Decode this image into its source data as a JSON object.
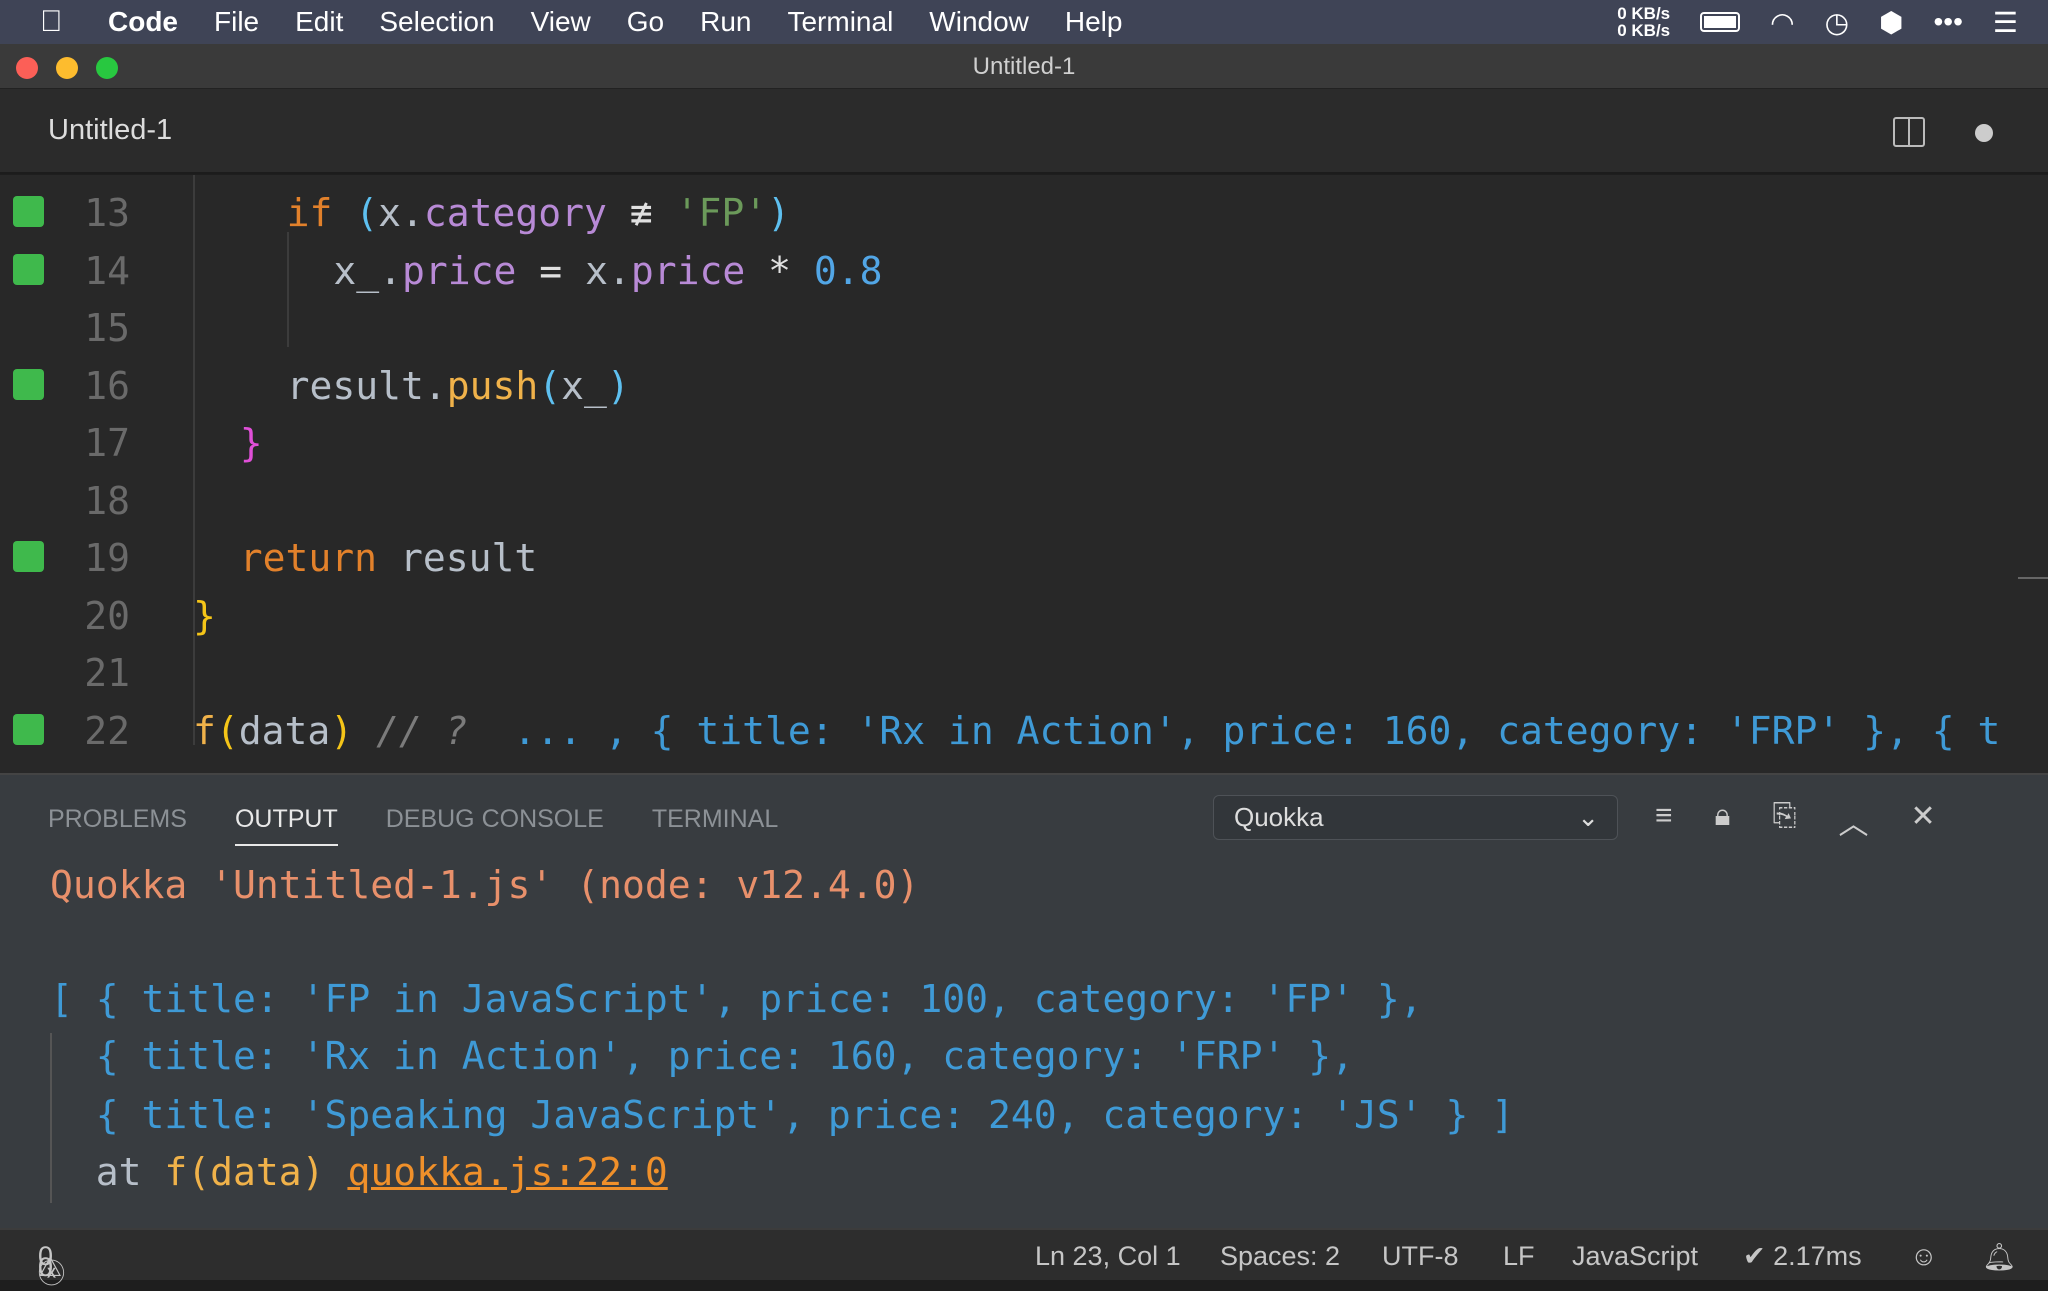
{
  "menubar": {
    "apple": "",
    "items": [
      "Code",
      "File",
      "Edit",
      "Selection",
      "View",
      "Go",
      "Run",
      "Terminal",
      "Window",
      "Help"
    ],
    "net_up": "0 KB/s",
    "net_down": "0 KB/s"
  },
  "window": {
    "title": "Untitled-1"
  },
  "tab": {
    "label": "Untitled-1"
  },
  "editor": {
    "lines": [
      {
        "n": "13",
        "mark": true,
        "indent": 4,
        "tokens": [
          {
            "t": "if",
            "c": "kw"
          },
          {
            "t": " ",
            "c": "tx"
          },
          {
            "t": "(",
            "c": "bb"
          },
          {
            "t": "x.",
            "c": "tx"
          },
          {
            "t": "category",
            "c": "pr"
          },
          {
            "t": " ≢ ",
            "c": "op"
          },
          {
            "t": "'FP'",
            "c": "st"
          },
          {
            "t": ")",
            "c": "bb"
          }
        ]
      },
      {
        "n": "14",
        "mark": true,
        "indent": 6,
        "tokens": [
          {
            "t": "x_.",
            "c": "tx"
          },
          {
            "t": "price",
            "c": "pr"
          },
          {
            "t": " = ",
            "c": "op"
          },
          {
            "t": "x.",
            "c": "tx"
          },
          {
            "t": "price",
            "c": "pr"
          },
          {
            "t": " * ",
            "c": "op"
          },
          {
            "t": "0.8",
            "c": "nu"
          }
        ]
      },
      {
        "n": "15",
        "mark": false,
        "indent": 0,
        "tokens": []
      },
      {
        "n": "16",
        "mark": true,
        "indent": 4,
        "tokens": [
          {
            "t": "result.",
            "c": "tx"
          },
          {
            "t": "push",
            "c": "fn"
          },
          {
            "t": "(",
            "c": "bb"
          },
          {
            "t": "x_",
            "c": "tx"
          },
          {
            "t": ")",
            "c": "bb"
          }
        ]
      },
      {
        "n": "17",
        "mark": false,
        "indent": 2,
        "tokens": [
          {
            "t": "}",
            "c": "bm"
          }
        ]
      },
      {
        "n": "18",
        "mark": false,
        "indent": 0,
        "tokens": []
      },
      {
        "n": "19",
        "mark": true,
        "indent": 2,
        "tokens": [
          {
            "t": "return",
            "c": "kw"
          },
          {
            "t": " result",
            "c": "tx"
          }
        ]
      },
      {
        "n": "20",
        "mark": false,
        "indent": 0,
        "tokens": [
          {
            "t": "}",
            "c": "by"
          }
        ]
      },
      {
        "n": "21",
        "mark": false,
        "indent": 0,
        "tokens": []
      },
      {
        "n": "22",
        "mark": true,
        "indent": 0,
        "tokens": [
          {
            "t": "f",
            "c": "fn"
          },
          {
            "t": "(",
            "c": "by"
          },
          {
            "t": "data",
            "c": "tx"
          },
          {
            "t": ")",
            "c": "by"
          },
          {
            "t": " // ?  ",
            "c": "cm"
          },
          {
            "t": "... , { title: 'Rx in Action', price: 160, category: 'FRP' }, { t",
            "c": "qv"
          }
        ]
      }
    ]
  },
  "panel": {
    "tabs": [
      "PROBLEMS",
      "OUTPUT",
      "DEBUG CONSOLE",
      "TERMINAL"
    ],
    "active": "OUTPUT",
    "channel": "Quokka",
    "header": "Quokka 'Untitled-1.js' (node: v12.4.0)",
    "output": [
      "[ { title: 'FP in JavaScript', price: 100, category: 'FP' },",
      "  { title: 'Rx in Action', price: 160, category: 'FRP' },",
      "  { title: 'Speaking JavaScript', price: 240, category: 'JS' } ]"
    ],
    "at_prefix": "  at ",
    "at_fn": "f(data)",
    "at_link": "quokka.js:22:0"
  },
  "status": {
    "errors": "0",
    "warnings": "0",
    "position": "Ln 23, Col 1",
    "spaces": "Spaces: 2",
    "encoding": "UTF-8",
    "eol": "LF",
    "language": "JavaScript",
    "timing": "✔ 2.17ms"
  },
  "colors": {
    "gutter_mark": "#3fb94c",
    "keyword": "#e2812b",
    "output": "#3f9ad6"
  }
}
